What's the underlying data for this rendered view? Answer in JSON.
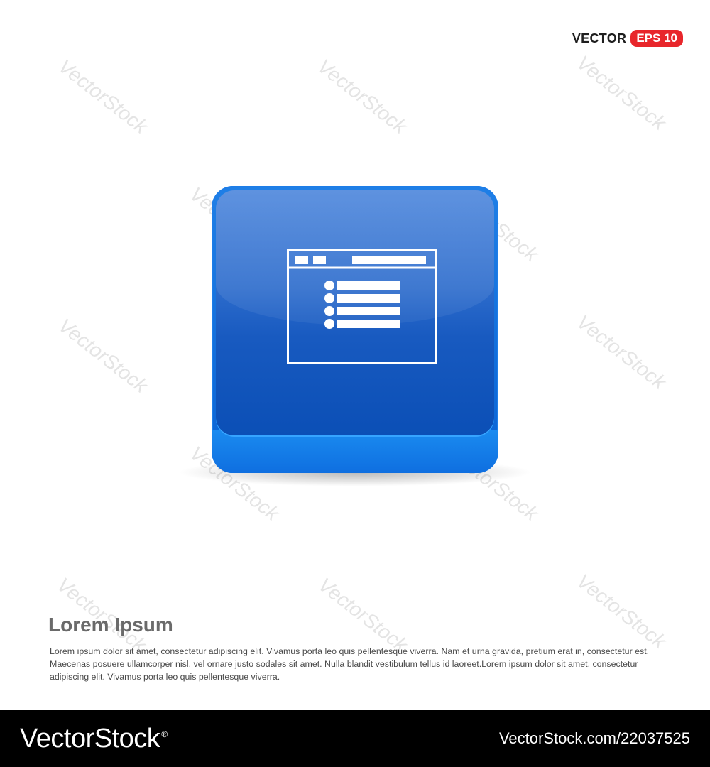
{
  "badge": {
    "vector_label": "VECTOR",
    "eps_label": "EPS 10"
  },
  "watermark": {
    "text": "VectorStock"
  },
  "icon": {
    "name": "browser-list-window-icon",
    "button_color": "#0a63d4",
    "glyph_color": "#ffffff"
  },
  "content": {
    "title": "Lorem Ipsum",
    "body": "Lorem ipsum dolor sit amet, consectetur adipiscing elit. Vivamus porta leo quis pellentesque viverra. Nam et urna gravida, pretium erat in, consectetur est. Maecenas posuere ullamcorper nisl, vel ornare justo sodales sit amet. Nulla blandit vestibulum tellus id laoreet.Lorem ipsum dolor sit amet, consectetur adipiscing elit. Vivamus porta leo quis pellentesque viverra."
  },
  "footer": {
    "logo": "VectorStock",
    "registered_mark": "®",
    "id_text": "VectorStock.com/22037525",
    "background": "#000000"
  }
}
